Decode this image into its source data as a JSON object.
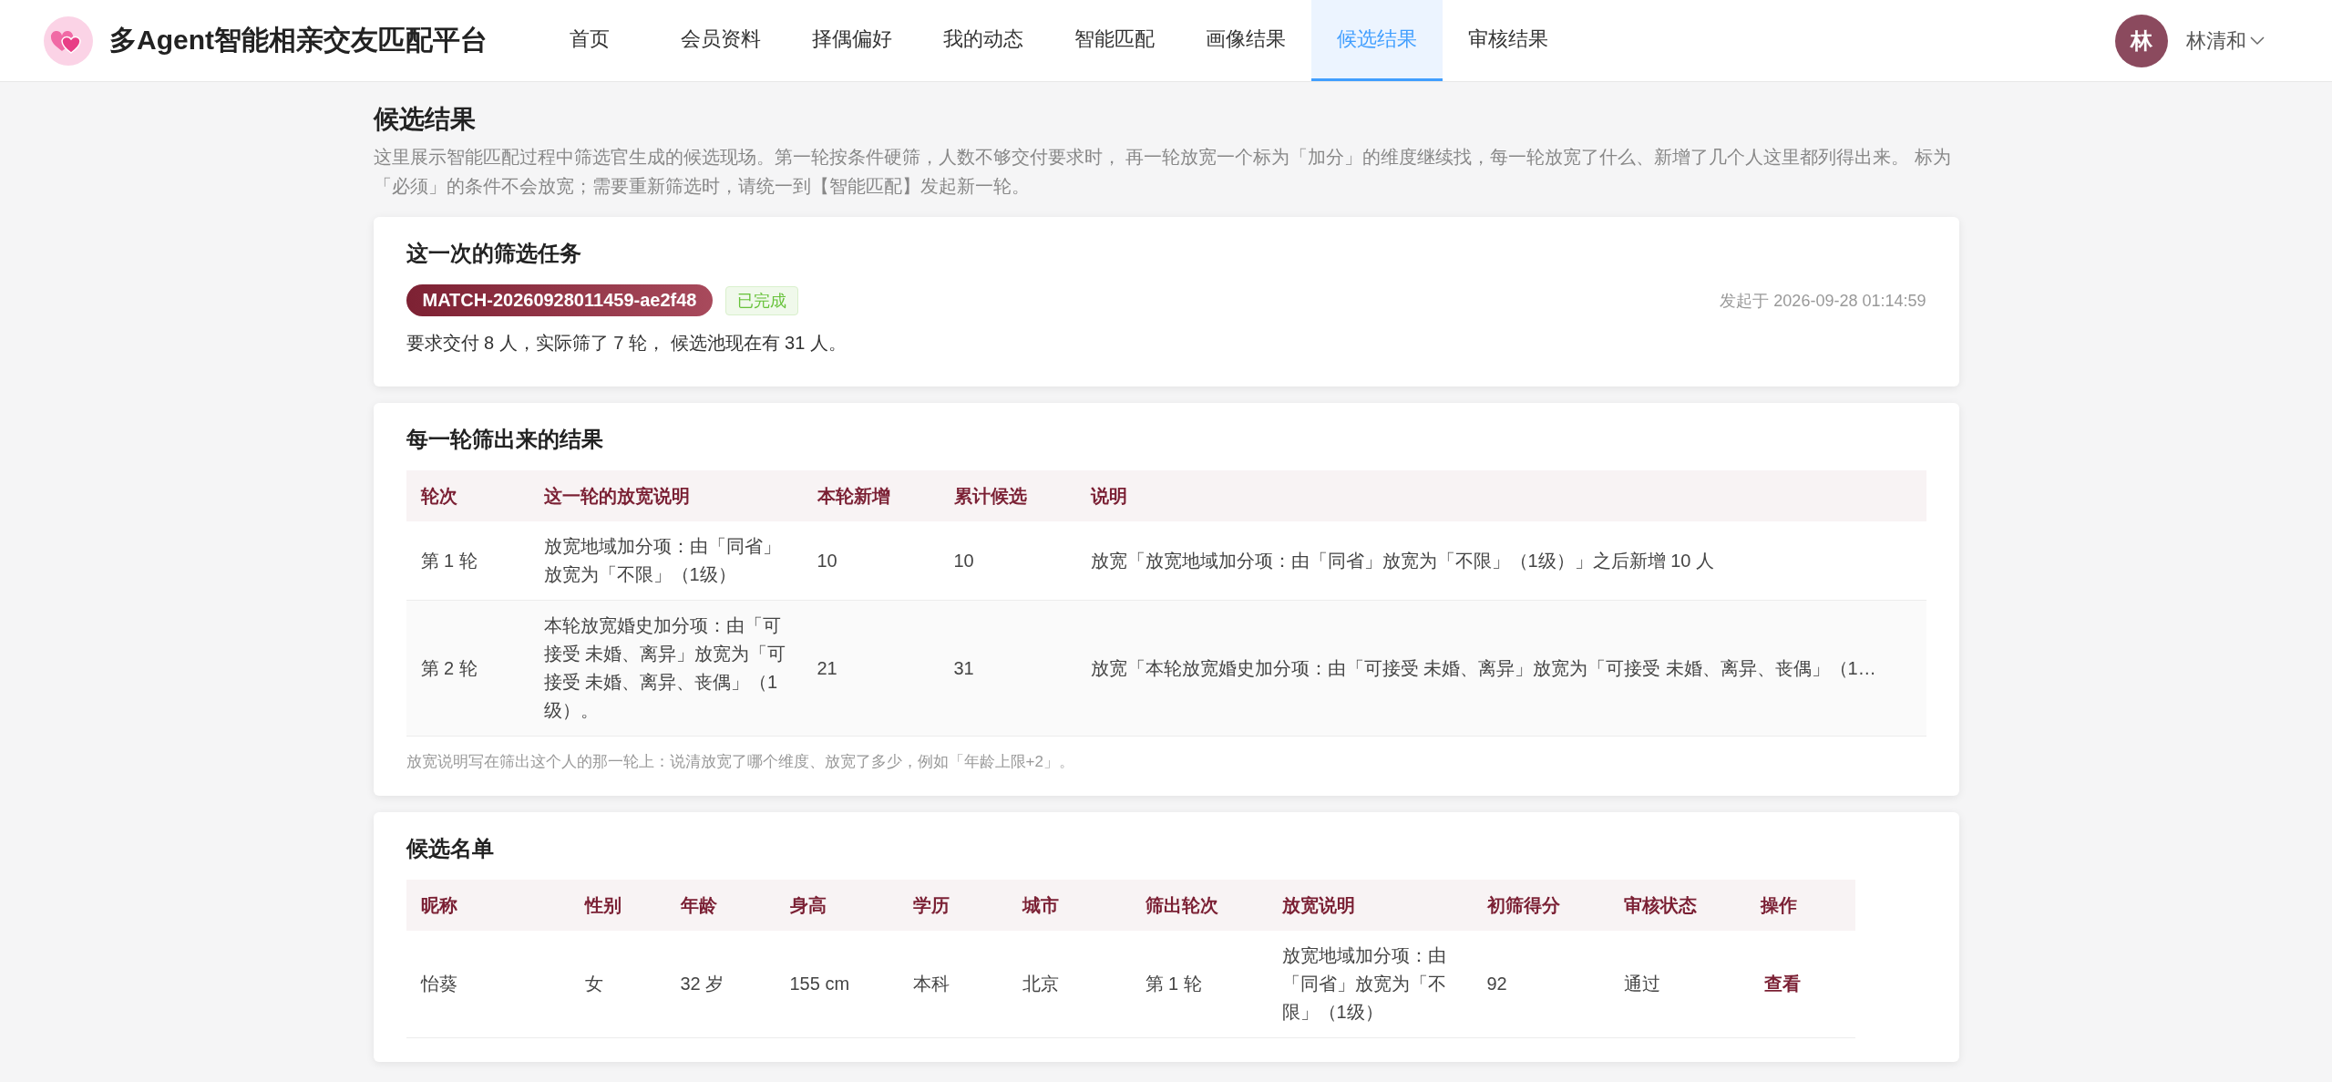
{
  "header": {
    "logo_text": "多Agent智能相亲交友匹配平台",
    "nav": [
      {
        "label": "首页",
        "selected": false
      },
      {
        "label": "会员资料",
        "selected": false
      },
      {
        "label": "择偶偏好",
        "selected": false
      },
      {
        "label": "我的动态",
        "selected": false
      },
      {
        "label": "智能匹配",
        "selected": false
      },
      {
        "label": "画像结果",
        "selected": false
      },
      {
        "label": "候选结果",
        "selected": true
      },
      {
        "label": "审核结果",
        "selected": false
      }
    ],
    "user": {
      "avatar_initial": "林",
      "name": "林清和"
    }
  },
  "page": {
    "title": "候选结果",
    "intro": "这里展示智能匹配过程中筛选官生成的候选现场。第一轮按条件硬筛，人数不够交付要求时， 再一轮放宽一个标为「加分」的维度继续找，每一轮放宽了什么、新增了几个人这里都列得出来。 标为「必须」的条件不会放宽；需要重新筛选时，请统一到【智能匹配】发起新一轮。"
  },
  "task_card": {
    "title": "这一次的筛选任务",
    "task_id": "MATCH-20260928011459-ae2f48",
    "status": "已完成",
    "started": "发起于 2026-09-28 01:14:59",
    "summary": "要求交付 8 人，实际筛了 7 轮， 候选池现在有 31 人。"
  },
  "rounds_card": {
    "title": "每一轮筛出来的结果",
    "columns": [
      "轮次",
      "这一轮的放宽说明",
      "本轮新增",
      "累计候选",
      "说明"
    ],
    "rows": [
      [
        "第 1 轮",
        "放宽地域加分项：由「同省」放宽为「不限」（1级）",
        "10",
        "10",
        "放宽「放宽地域加分项：由「同省」放宽为「不限」（1级）」之后新增 10 人"
      ],
      [
        "第 2 轮",
        "本轮放宽婚史加分项：由「可接受 未婚、离异」放宽为「可接受 未婚、离异、丧偶」（1级）。",
        "21",
        "31",
        "放宽「本轮放宽婚史加分项：由「可接受 未婚、离异」放宽为「可接受 未婚、离异、丧偶」（1…"
      ]
    ],
    "note": "放宽说明写在筛出这个人的那一轮上：说清放宽了哪个维度、放宽了多少，例如「年龄上限+2」。"
  },
  "candidates_card": {
    "title": "候选名单",
    "columns": [
      "昵称",
      "性别",
      "年龄",
      "身高",
      "学历",
      "城市",
      "筛出轮次",
      "放宽说明",
      "初筛得分",
      "审核状态",
      "操作"
    ],
    "rows": [
      {
        "cells": [
          "怡葵",
          "女",
          "32 岁",
          "155 cm",
          "本科",
          "北京",
          "第 1 轮",
          "放宽地域加分项：由「同省」放宽为「不限」（1级）",
          "92",
          "通过"
        ],
        "action": "查看"
      }
    ]
  }
}
